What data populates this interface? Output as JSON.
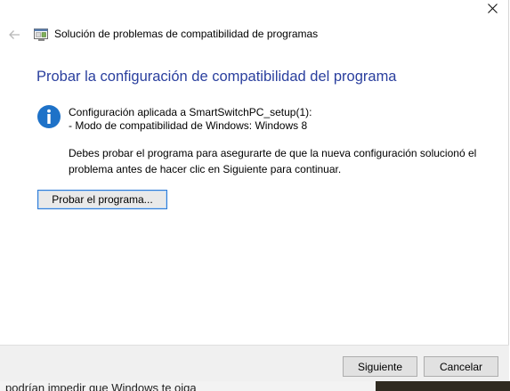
{
  "window": {
    "nav_title": "Solución de problemas de compatibilidad de programas"
  },
  "main": {
    "heading": "Probar la configuración de compatibilidad del programa",
    "info_line_1": "Configuración aplicada a SmartSwitchPC_setup(1):",
    "info_line_2": "- Modo de compatibilidad de Windows: Windows 8",
    "description": "Debes probar el programa para asegurarte de que la nueva configuración solucionó el problema antes de hacer clic en Siguiente para continuar.",
    "test_button_label": "Probar el programa..."
  },
  "footer": {
    "next_label": "Siguiente",
    "cancel_label": "Cancelar"
  },
  "background": {
    "partial_text": "podrían impedir que Windows te oiga"
  },
  "icons": [
    "close-icon",
    "back-arrow-icon",
    "program-compatibility-icon",
    "info-icon"
  ],
  "colors": {
    "heading": "#2a3f9e",
    "info_icon": "#1e72c8",
    "focus_border": "#2f7bd6",
    "footer_bg": "#f0f0f0"
  }
}
